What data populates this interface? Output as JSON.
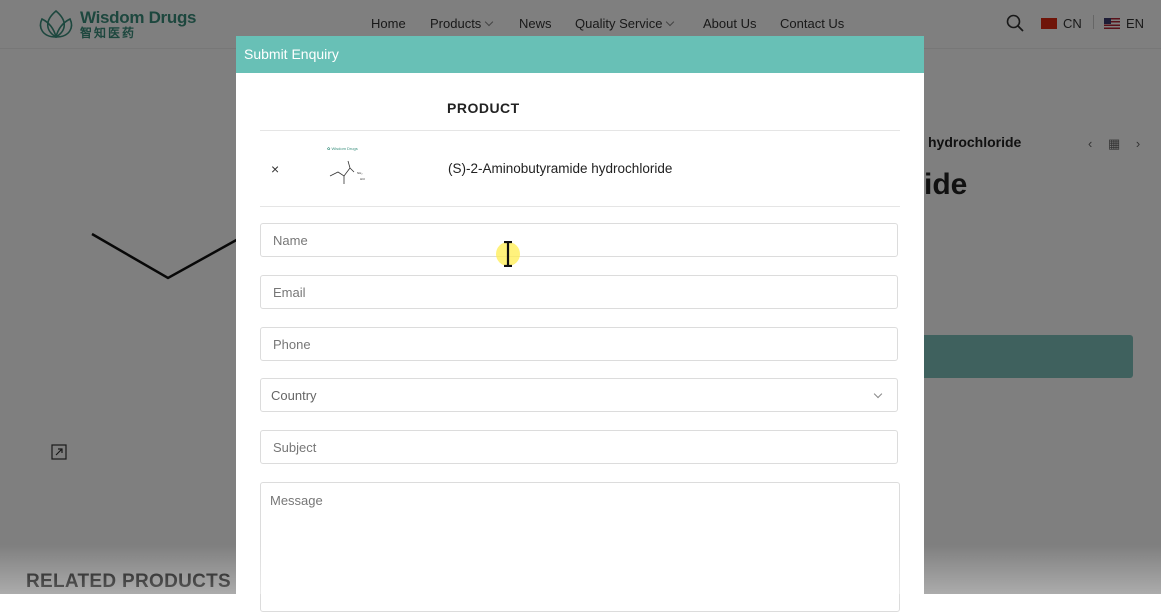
{
  "header": {
    "logo_en": "Wisdom Drugs",
    "logo_cn": "智知医药",
    "nav": [
      {
        "label": "Home",
        "has_dropdown": false
      },
      {
        "label": "Products",
        "has_dropdown": true
      },
      {
        "label": "News",
        "has_dropdown": false
      },
      {
        "label": "Quality Service",
        "has_dropdown": true
      },
      {
        "label": "About Us",
        "has_dropdown": false
      },
      {
        "label": "Contact Us",
        "has_dropdown": false
      }
    ],
    "icons": {
      "search": "search-icon"
    },
    "lang_cn": "CN",
    "lang_en": "EN"
  },
  "background": {
    "product_title": "hydrochloride",
    "big_title": "ide",
    "related_heading": "RELATED PRODUCTS"
  },
  "modal": {
    "title": "Submit Enquiry",
    "column_product": "PRODUCT",
    "remove_symbol": "×",
    "product_name": "(S)-2-Aminobutyramide hydrochloride",
    "form": {
      "name_placeholder": "Name",
      "email_placeholder": "Email",
      "phone_placeholder": "Phone",
      "country_placeholder": "Country",
      "subject_placeholder": "Subject",
      "message_placeholder": "Message"
    }
  },
  "colors": {
    "brand": "#3a8f7d",
    "modal_header": "#68c0b6",
    "accent_button": "#7fc2bd"
  }
}
